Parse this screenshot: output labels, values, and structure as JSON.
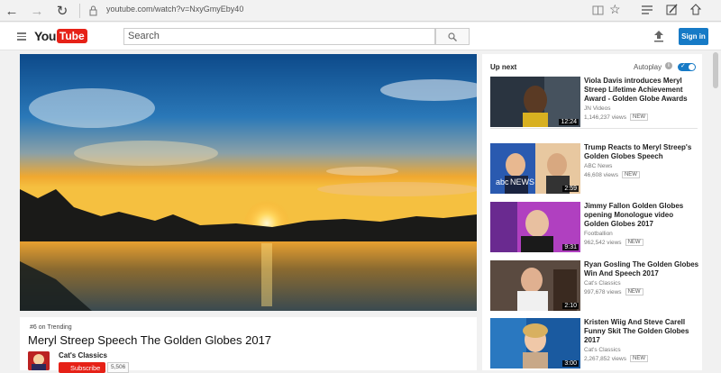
{
  "browser": {
    "url": "youtube.com/watch?v=NxyGmyEby40"
  },
  "header": {
    "logo_you": "You",
    "logo_tube": "Tube",
    "search_placeholder": "Search",
    "signin_label": "Sign in"
  },
  "video": {
    "trending": "#6 on Trending",
    "title": "Meryl Streep Speech The Golden Globes 2017",
    "channel": "Cat's Classics",
    "subscribe_label": "Subscribe",
    "subscriber_count": "5,506"
  },
  "sidebar": {
    "up_next": "Up next",
    "autoplay": "Autoplay",
    "autoplay_on": true,
    "items": [
      {
        "title": "Viola Davis introduces Meryl Streep Lifetime Achievement Award - Golden Globe Awards",
        "channel": "JN Videos",
        "views": "1,146,237 views",
        "badge": "NEW",
        "duration": "12:24"
      },
      {
        "title": "Trump Reacts to Meryl Streep's Golden Globes Speech",
        "channel": "ABC News",
        "views": "46,608 views",
        "badge": "NEW",
        "duration": "2:59"
      },
      {
        "title": "Jimmy Fallon Golden Globes opening Monologue video Golden Globes 2017",
        "channel": "Footballion",
        "views": "962,542 views",
        "badge": "NEW",
        "duration": "9:31"
      },
      {
        "title": "Ryan Gosling The Golden Globes Win And Speech 2017",
        "channel": "Cat's Classics",
        "views": "997,678 views",
        "badge": "NEW",
        "duration": "2:10"
      },
      {
        "title": "Kristen Wiig And Steve Carell Funny Skit The Golden Globes 2017",
        "channel": "Cat's Classics",
        "views": "2,267,852 views",
        "badge": "NEW",
        "duration": "3:00"
      }
    ]
  },
  "colors": {
    "brand_red": "#e62117",
    "accent_blue": "#167ac6"
  }
}
